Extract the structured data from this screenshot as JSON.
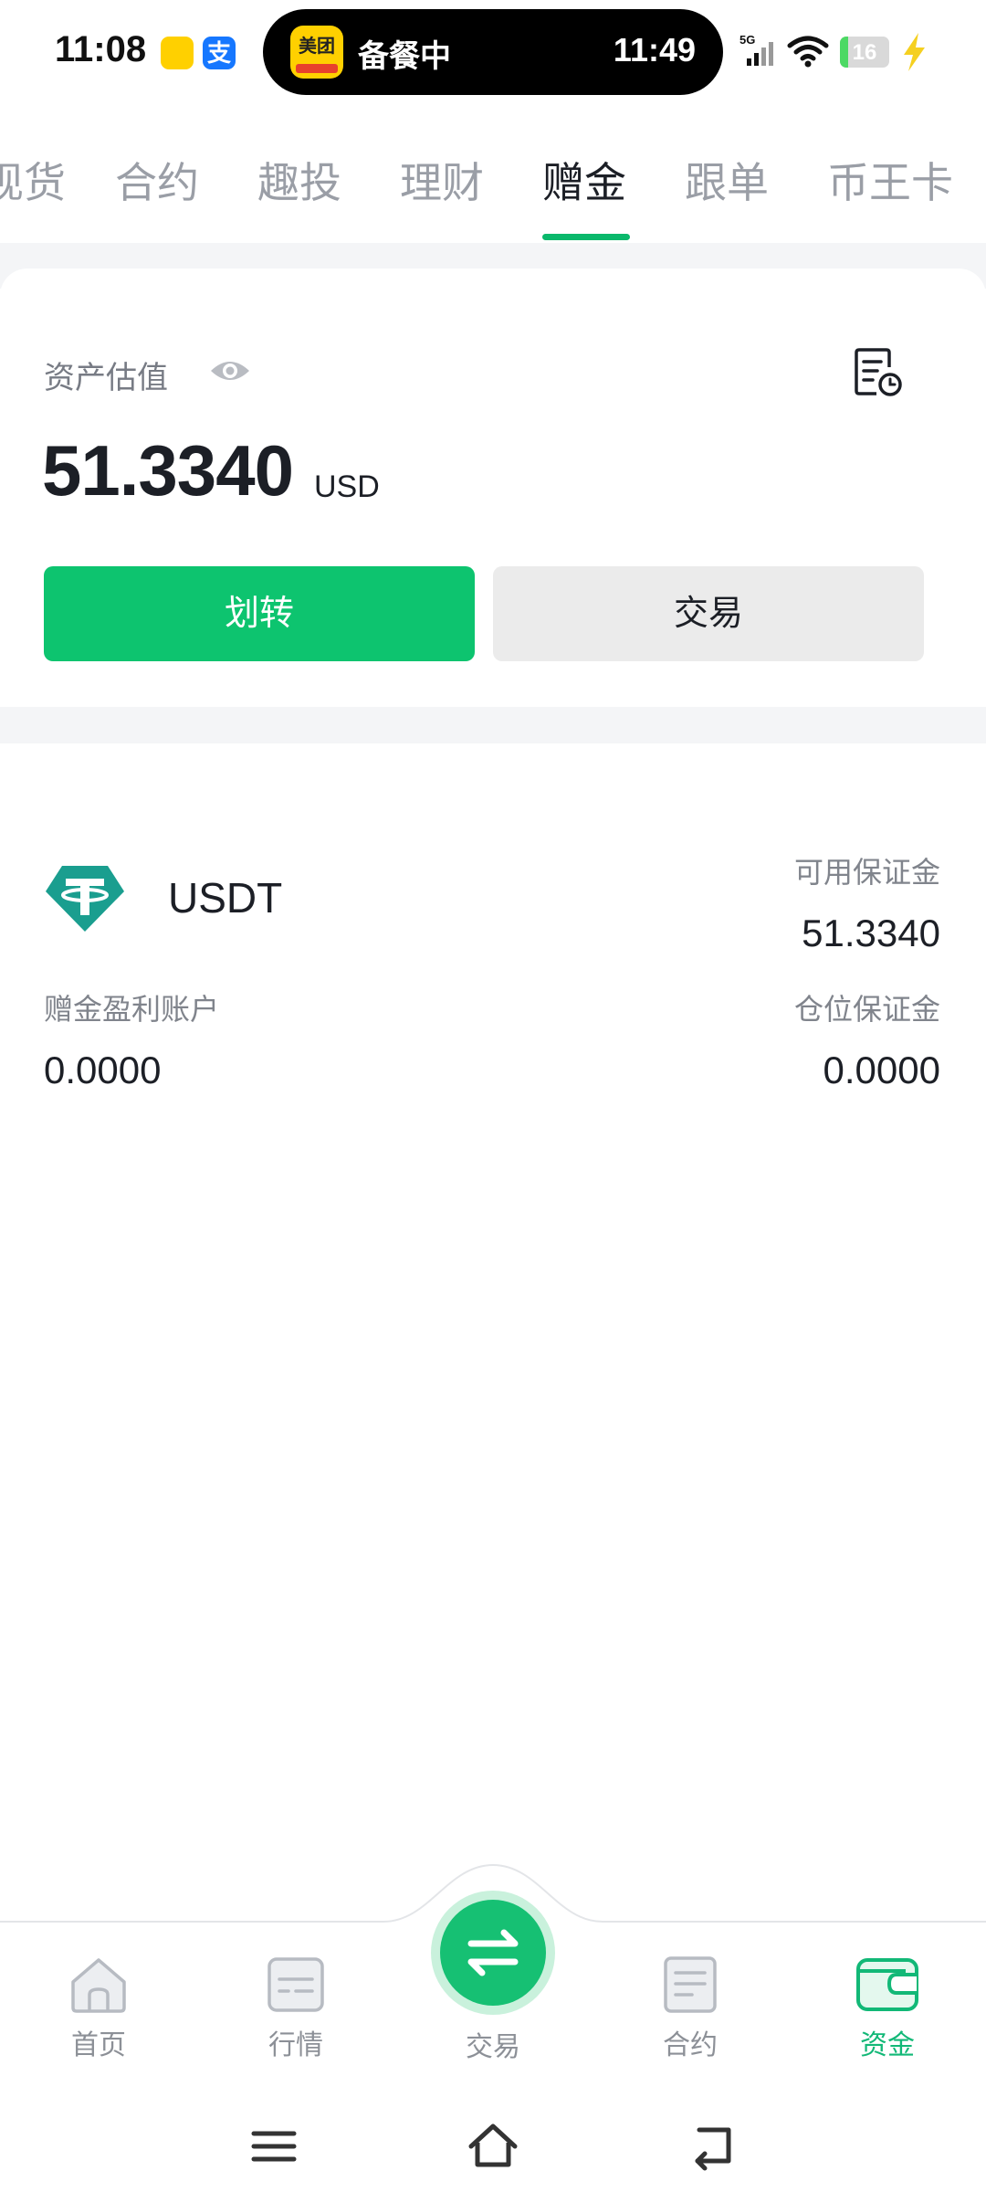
{
  "status_bar": {
    "time": "11:08",
    "island_text": "备餐中",
    "island_logo_text": "美团",
    "island_time": "11:49",
    "network": "5G",
    "battery": "16"
  },
  "top_tabs": [
    {
      "label": "现货"
    },
    {
      "label": "合约"
    },
    {
      "label": "趣投"
    },
    {
      "label": "理财"
    },
    {
      "label": "赠金",
      "active": true
    },
    {
      "label": "跟单"
    },
    {
      "label": "币王卡"
    }
  ],
  "asset": {
    "label": "资产估值",
    "value": "51.3340",
    "unit": "USD"
  },
  "actions": {
    "transfer": "划转",
    "trade": "交易"
  },
  "coin": {
    "name": "USDT",
    "available_margin_label": "可用保证金",
    "available_margin": "51.3340",
    "bonus_profit_label": "赠金盈利账户",
    "bonus_profit": "0.0000",
    "position_margin_label": "仓位保证金",
    "position_margin": "0.0000"
  },
  "bottom_nav": [
    {
      "label": "首页",
      "icon": "home-icon"
    },
    {
      "label": "行情",
      "icon": "market-icon"
    },
    {
      "label": "交易",
      "icon": "swap-icon"
    },
    {
      "label": "合约",
      "icon": "contract-icon"
    },
    {
      "label": "资金",
      "icon": "wallet-icon",
      "active": true
    }
  ],
  "colors": {
    "accent": "#0dc46f",
    "tab_indicator": "#0ab86b",
    "tether": "#1a9e8f"
  }
}
